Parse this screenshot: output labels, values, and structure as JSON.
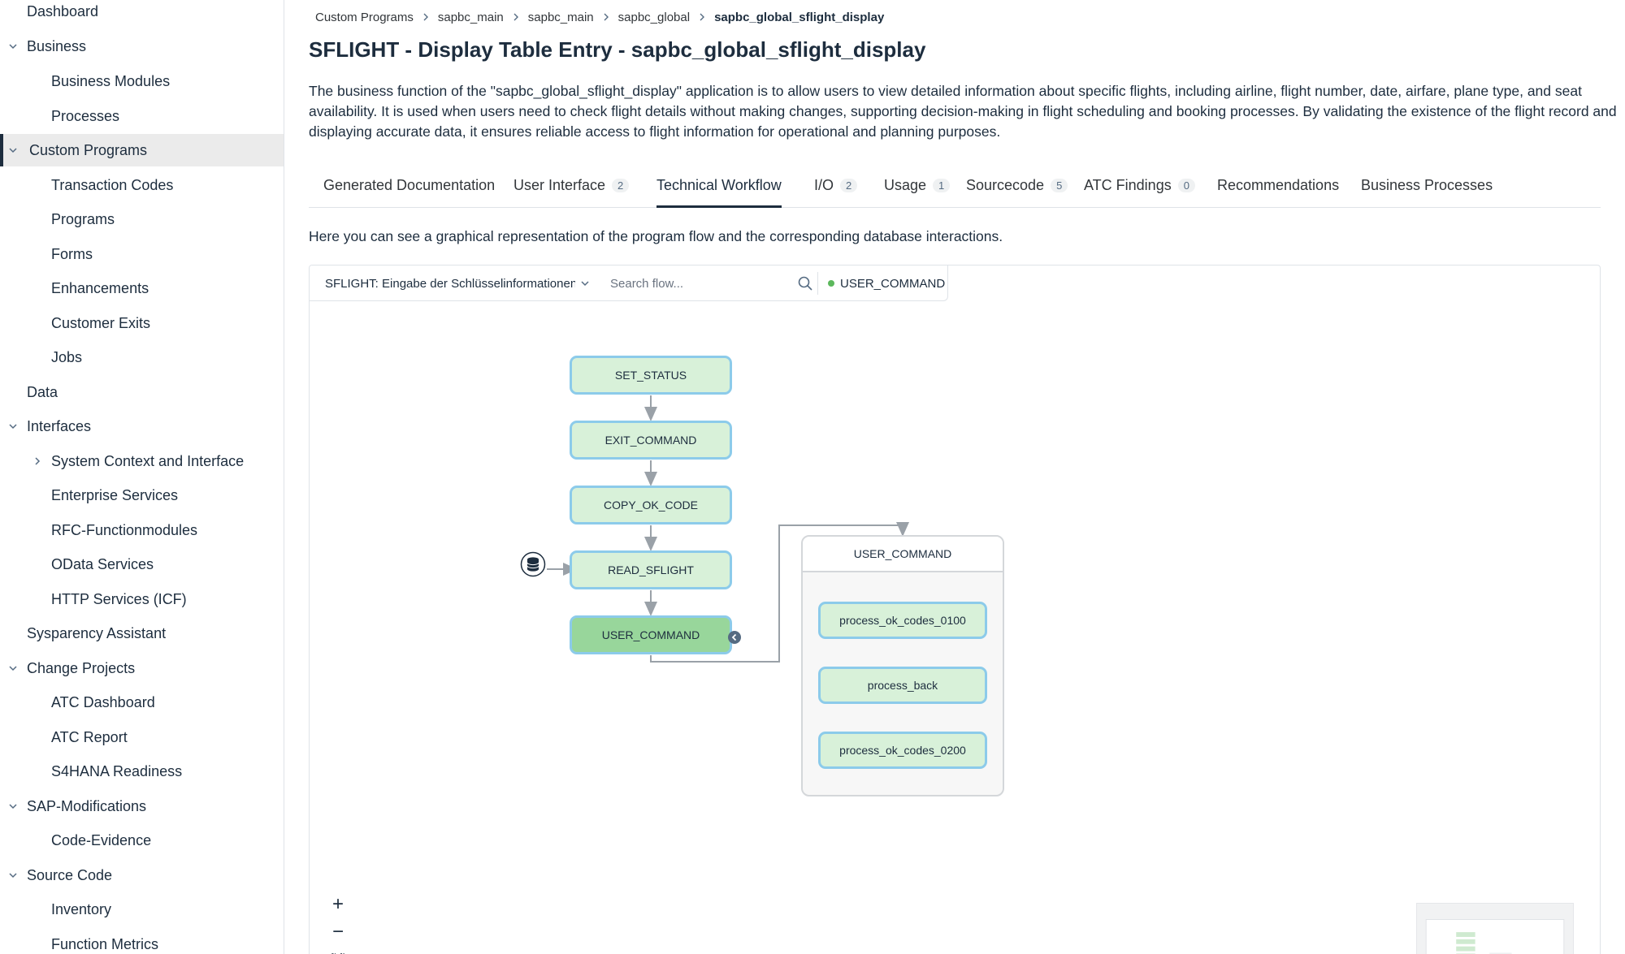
{
  "sidebar": {
    "items": [
      {
        "label": "Dashboard"
      },
      {
        "label": "Business"
      },
      {
        "label": "Business Modules"
      },
      {
        "label": "Processes"
      },
      {
        "label": "Custom Programs"
      },
      {
        "label": "Transaction Codes"
      },
      {
        "label": "Programs"
      },
      {
        "label": "Forms"
      },
      {
        "label": "Enhancements"
      },
      {
        "label": "Customer Exits"
      },
      {
        "label": "Jobs"
      },
      {
        "label": "Data"
      },
      {
        "label": "Interfaces"
      },
      {
        "label": "System Context and Interface"
      },
      {
        "label": "Enterprise Services"
      },
      {
        "label": "RFC-Functionmodules"
      },
      {
        "label": "OData Services"
      },
      {
        "label": "HTTP Services (ICF)"
      },
      {
        "label": "Sysparency Assistant"
      },
      {
        "label": "Change Projects"
      },
      {
        "label": "ATC Dashboard"
      },
      {
        "label": "ATC Report"
      },
      {
        "label": "S4HANA Readiness"
      },
      {
        "label": "SAP-Modifications"
      },
      {
        "label": "Code-Evidence"
      },
      {
        "label": "Source Code"
      },
      {
        "label": "Inventory"
      },
      {
        "label": "Function Metrics"
      }
    ]
  },
  "breadcrumb": [
    "Custom Programs",
    "sapbc_main",
    "sapbc_main",
    "sapbc_global",
    "sapbc_global_sflight_display"
  ],
  "page": {
    "title": "SFLIGHT - Display Table Entry - sapbc_global_sflight_display",
    "description": "The business function of the \"sapbc_global_sflight_display\" application is to allow users to view detailed information about specific flights, including airline, flight number, date, airfare, plane type, and seat availability. It is used when users need to check flight details without making changes, supporting decision-making in flight scheduling and booking processes. By validating the existence of the flight record and displaying accurate data, it ensures reliable access to flight information for operational and planning purposes."
  },
  "tabs": [
    {
      "label": "Generated Documentation",
      "badge": null
    },
    {
      "label": "User Interface",
      "badge": "2"
    },
    {
      "label": "Technical Workflow",
      "badge": null
    },
    {
      "label": "I/O",
      "badge": "2"
    },
    {
      "label": "Usage",
      "badge": "1"
    },
    {
      "label": "Sourcecode",
      "badge": "5"
    },
    {
      "label": "ATC Findings",
      "badge": "0"
    },
    {
      "label": "Recommendations",
      "badge": null
    },
    {
      "label": "Business Processes",
      "badge": null
    }
  ],
  "workflow": {
    "intro": "Here you can see a graphical representation of the program flow and the corresponding database interactions.",
    "flow_select_value": "SFLIGHT: Eingabe der Schlüsselinformationen (",
    "search_placeholder": "Search flow...",
    "status_label": "USER_COMMAND",
    "status_color": "#5cb85c",
    "nodes": {
      "set_status": "SET_STATUS",
      "exit_command": "EXIT_COMMAND",
      "copy_ok_code": "COPY_OK_CODE",
      "read_sflight": "READ_SFLIGHT",
      "user_command": "USER_COMMAND"
    },
    "group": {
      "title": "USER_COMMAND",
      "nodes": [
        "process_ok_codes_0100",
        "process_back",
        "process_ok_codes_0200"
      ]
    },
    "zoom_in": "+",
    "zoom_out": "−"
  },
  "icons": {
    "nav_chevron": "chevron-down-icon",
    "breadcrumb_sep": "chevron-right-icon",
    "search": "search-icon",
    "database": "database-icon",
    "collapse": "chevron-left-icon",
    "fit": "fit-view-icon"
  }
}
